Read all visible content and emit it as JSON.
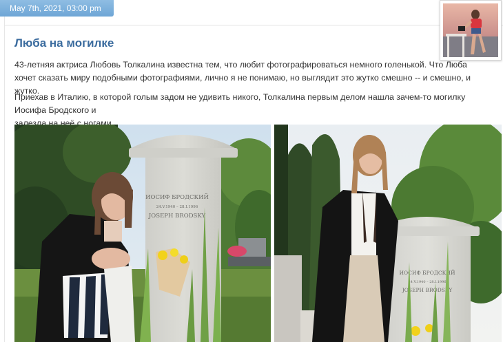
{
  "post": {
    "date": "May 7th, 2021, 03:00 pm",
    "title": "Люба на могилке",
    "paragraph_1_line_1": "43-летняя актриса Любовь Толкалина известна тем, что любит фотографироваться немного голенькой. Что Люба",
    "paragraph_1_line_2": "хочет сказать миру подобными фотографиями, лично я не понимаю, но выглядит это жутко смешно -- и смешно, и жутко.",
    "paragraph_2_line_1": "Приехав в Италию, в которой голым задом не удивить никого, Толкалина первым делом нашла зачем-то могилку Иосифа Бродского и",
    "paragraph_2_line_2": "залезла на неё с ногами."
  },
  "photos": {
    "left": {
      "stone_line_1": "ИОСИФ БРОДСКИЙ",
      "stone_line_2": "24.V.1940 – 28.I.1996",
      "stone_line_3": "JOSEPH BRODSKY"
    },
    "right": {
      "stone_line_1": "ИОСИФ БРОДСКИЙ",
      "stone_line_2": "24.V.1940 – 28.I.1996",
      "stone_line_3": "JOSEPH BRODSKY"
    }
  },
  "colors": {
    "date_tab": "#7bb0dc",
    "title": "#3a6b9e",
    "body_text": "#333333"
  }
}
